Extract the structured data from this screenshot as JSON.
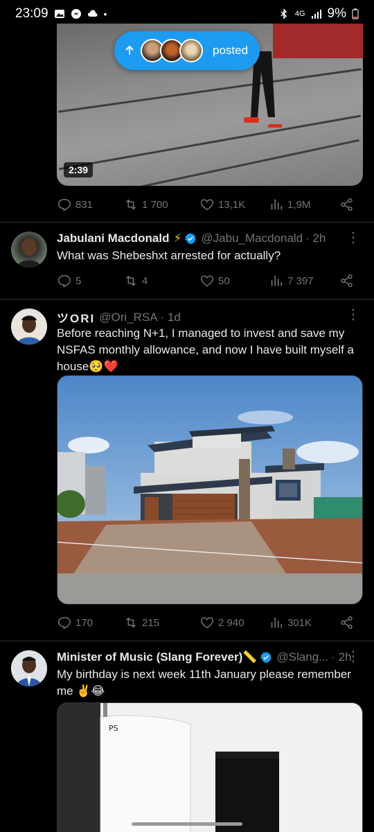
{
  "status_bar": {
    "time": "23:09",
    "network": "4G",
    "battery": "9%"
  },
  "video_tweet": {
    "duration": "2:39",
    "posted_pill": {
      "label": "posted"
    },
    "actions": {
      "replies": "831",
      "reposts": "1 700",
      "likes": "13,1K",
      "views": "1,9M"
    }
  },
  "tweets": [
    {
      "name": "Jabulani Macdonald",
      "handle": "@Jabu_Macdonald",
      "time": "· 2h",
      "text": "What was Shebeshxt arrested for actually?",
      "actions": {
        "replies": "5",
        "reposts": "4",
        "likes": "50",
        "views": "7 397"
      }
    },
    {
      "name": "ツORI",
      "handle": "@Ori_RSA",
      "time": "· 1d",
      "text": "Before reaching N+1, I managed to invest and save my NSFAS monthly allowance, and now I have built myself a house🥺❤️",
      "actions": {
        "replies": "170",
        "reposts": "215",
        "likes": "2 940",
        "views": "301K"
      }
    },
    {
      "name": "Minister of Music (Slang Forever)📏",
      "handle": "@Slang...",
      "time": "· 2h",
      "text": "My birthday is next week 11th January please remember me ✌️😂"
    }
  ],
  "colors": {
    "accent": "#1d9bf0",
    "muted": "#71767b",
    "background": "#000000",
    "verified": "#1d9bf0"
  },
  "icons": [
    "reply-icon",
    "repost-icon",
    "like-icon",
    "views-icon",
    "share-icon",
    "verified-icon",
    "more-icon",
    "arrow-up-icon"
  ]
}
